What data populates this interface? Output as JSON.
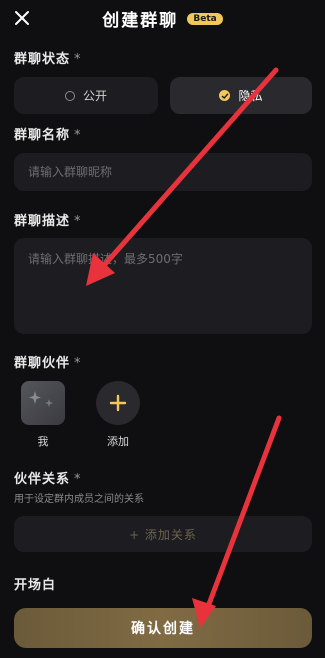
{
  "header": {
    "title": "创建群聊",
    "beta_badge": "Beta",
    "close_icon": "close-icon"
  },
  "status": {
    "label": "群聊状态",
    "required_mark": "*",
    "options": [
      {
        "label": "公开",
        "selected": false
      },
      {
        "label": "隐私",
        "selected": true
      }
    ]
  },
  "name": {
    "label": "群聊名称",
    "required_mark": "*",
    "placeholder": "请输入群聊昵称"
  },
  "description": {
    "label": "群聊描述",
    "required_mark": "*",
    "placeholder": "请输入群聊描述，最多500字"
  },
  "partners": {
    "label": "群聊伙伴",
    "required_mark": "*",
    "items": [
      {
        "caption": "我"
      },
      {
        "caption": "添加",
        "icon": "plus-icon"
      }
    ]
  },
  "relations": {
    "label": "伙伴关系",
    "required_mark": "*",
    "subtitle": "用于设定群内成员之间的关系",
    "add_button": "+ 添加关系"
  },
  "opening": {
    "label": "开场白"
  },
  "confirm_button": "确认创建",
  "colors": {
    "background": "#0f0f11",
    "accent": "#f3c85a",
    "annotation_arrow": "#e8333d"
  }
}
